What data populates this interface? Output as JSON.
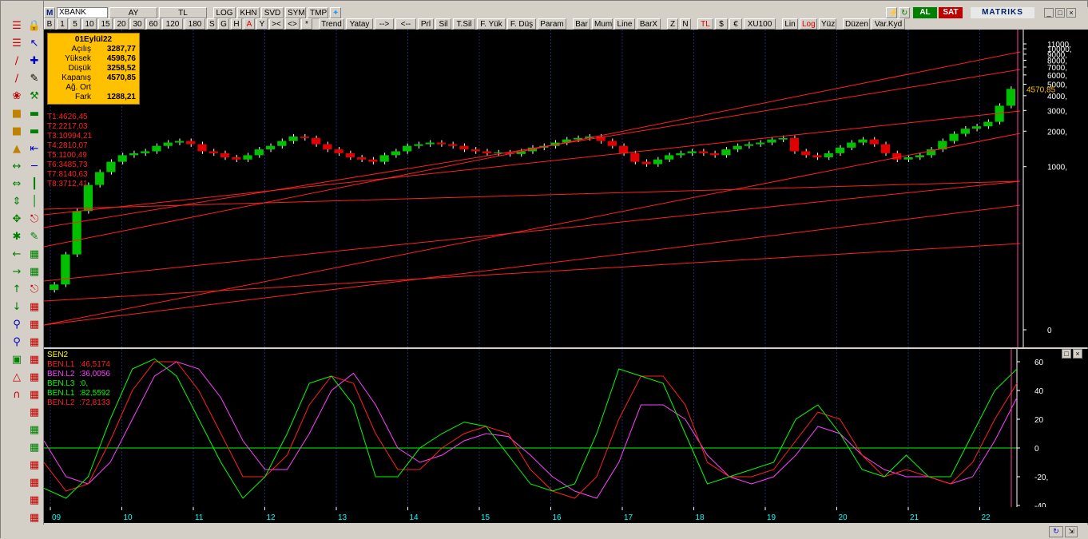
{
  "toolbar1": {
    "m_label": "M",
    "symbol": "XBANK",
    "period": "AY",
    "currency": "TL",
    "log": "LOG",
    "khn": "KHN",
    "svd": "SVD",
    "sym": "SYM",
    "tmp": "TMP",
    "al": "AL",
    "sat": "SAT",
    "brand": "MATRIKS"
  },
  "toolbar2": {
    "buttons": [
      "B",
      "1",
      "5",
      "10",
      "15",
      "20",
      "30",
      "60",
      "120",
      "180",
      "S",
      "G",
      "H",
      "A",
      "Y",
      "><",
      "<>",
      "*",
      "Trend",
      "Yatay",
      "-->",
      "<--",
      "Prl",
      "Sil",
      "T.Sil",
      "F. Yük",
      "F. Düş",
      "Param",
      "Bar",
      "Mum",
      "Line",
      "BarX",
      "Z",
      "N",
      "TL",
      "$",
      "€",
      "XU100",
      "Lin",
      "Log",
      "Yüz",
      "Düzen",
      "Var.Kyd"
    ]
  },
  "ohlc": {
    "date": "01Eylül22",
    "rows": [
      {
        "label": "Açılış",
        "value": "3287,77"
      },
      {
        "label": "Yüksek",
        "value": "4598,76"
      },
      {
        "label": "Düşük",
        "value": "3258,52"
      },
      {
        "label": "Kapanış",
        "value": "4570,85"
      },
      {
        "label": "Ağ. Ort",
        "value": ""
      },
      {
        "label": "Fark",
        "value": "1288,21"
      }
    ]
  },
  "trend_lines": [
    "T1:4626,45",
    "T2:2217,03",
    "T3:10994,21",
    "T4:2810,07",
    "T5:1100,49",
    "T6:3485,73",
    "T7:8140,63",
    "T8:3712,41"
  ],
  "indicator": {
    "name": "SEN2",
    "series": [
      {
        "label": "BEN.L1",
        "value": ":46,5174",
        "color": "#ff2020"
      },
      {
        "label": "BEN.L2",
        "value": ":36,0056",
        "color": "#ff40ff"
      },
      {
        "label": "BEN.L3",
        "value": ":0,",
        "color": "#00ff00"
      },
      {
        "label": "BEN.L1",
        "value": ":82,5592",
        "color": "#00ff00"
      },
      {
        "label": "BEN.L2",
        "value": ":72,8133",
        "color": "#ff2020"
      }
    ]
  },
  "colors": {
    "up": "#00c000",
    "down": "#e00000",
    "trend": "#ff2020",
    "axis": "#ffffff",
    "last": "#ffc000"
  },
  "chart_data": [
    {
      "type": "candlestick",
      "title": "XBANK",
      "scale": "log",
      "y_ticks": [
        "11000,",
        "10000,",
        "9000,",
        "8000,",
        "7000,",
        "6000,",
        "5000,",
        "4000,",
        "3000,",
        "2000,",
        "1000,",
        "0"
      ],
      "last_price": "4570,85",
      "x_labels": [
        "09",
        "10",
        "11",
        "12",
        "13",
        "14",
        "15",
        "16",
        "17",
        "18",
        "19",
        "20",
        "21",
        "22"
      ],
      "close_approx": [
        100,
        180,
        420,
        700,
        900,
        1100,
        1250,
        1300,
        1350,
        1500,
        1600,
        1650,
        1550,
        1350,
        1300,
        1200,
        1150,
        1250,
        1400,
        1500,
        1650,
        1800,
        1750,
        1550,
        1400,
        1300,
        1200,
        1150,
        1100,
        1250,
        1350,
        1500,
        1550,
        1600,
        1550,
        1500,
        1400,
        1350,
        1300,
        1320,
        1280,
        1350,
        1450,
        1500,
        1600,
        1700,
        1750,
        1800,
        1650,
        1500,
        1300,
        1100,
        1050,
        1150,
        1250,
        1300,
        1350,
        1300,
        1250,
        1400,
        1500,
        1550,
        1600,
        1700,
        1750,
        1350,
        1250,
        1200,
        1300,
        1450,
        1600,
        1700,
        1550,
        1300,
        1150,
        1200,
        1250,
        1400,
        1650,
        1900,
        2100,
        2200,
        2400,
        3287,
        4570
      ],
      "ylim": [
        0,
        11000
      ]
    },
    {
      "type": "line",
      "title": "SEN2",
      "y_ticks": [
        "60",
        "40",
        "20",
        "0",
        "-20,",
        "-40"
      ],
      "ylim": [
        -40,
        65
      ]
    }
  ]
}
